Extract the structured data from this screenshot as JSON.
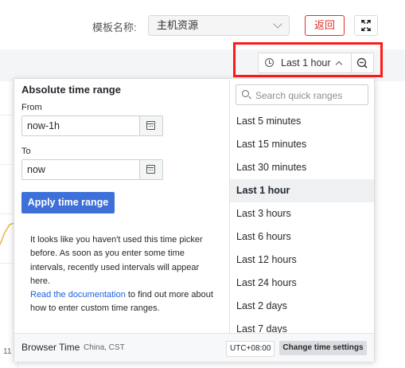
{
  "toolbar": {
    "template_label": "模板名称:",
    "template_value": "主机资源",
    "back_label": "返回"
  },
  "time_picker": {
    "current_range": "Last 1 hour"
  },
  "absolute": {
    "title": "Absolute time range",
    "from_label": "From",
    "from_value": "now-1h",
    "to_label": "To",
    "to_value": "now",
    "apply_label": "Apply time range",
    "info_text": "It looks like you haven't used this time picker before. As soon as you enter some time intervals, recently used intervals will appear here.",
    "doc_link": "Read the documentation",
    "doc_suffix": " to find out more about how to enter custom time ranges."
  },
  "quick": {
    "search_placeholder": "Search quick ranges",
    "items": [
      "Last 5 minutes",
      "Last 15 minutes",
      "Last 30 minutes",
      "Last 1 hour",
      "Last 3 hours",
      "Last 6 hours",
      "Last 12 hours",
      "Last 24 hours",
      "Last 2 days",
      "Last 7 days"
    ],
    "active_index": 3
  },
  "footer": {
    "browser_time": "Browser Time",
    "timezone": "China, CST",
    "offset": "UTC+08:00",
    "change_btn": "Change time settings"
  },
  "background": {
    "axis_tick": "11"
  },
  "colors": {
    "highlight": "#ff1a1a",
    "primary": "#3d71d9",
    "back": "#e0312b"
  }
}
